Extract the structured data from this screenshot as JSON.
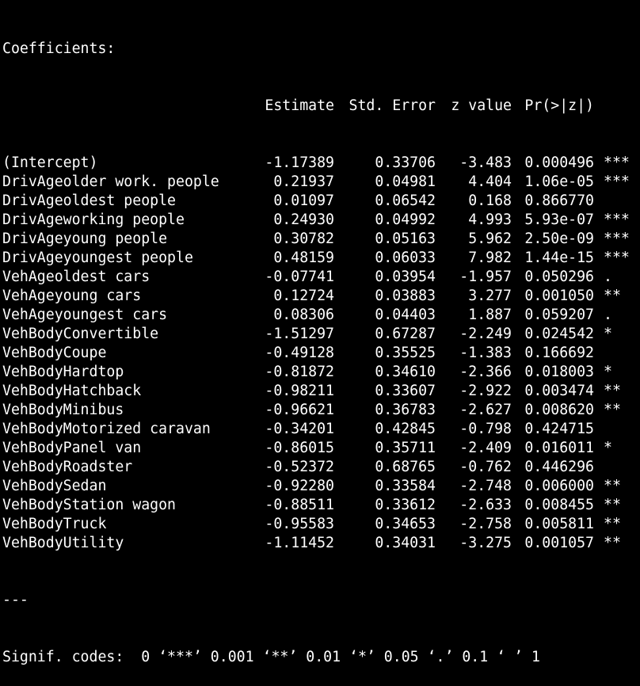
{
  "heading": "Coefficients:",
  "columns": [
    "Estimate",
    "Std. Error",
    "z value",
    "Pr(>|z|)"
  ],
  "rows": [
    {
      "name": "(Intercept)",
      "estimate": "-1.17389",
      "std_error": "0.33706",
      "z_value": "-3.483",
      "p_value": "0.000496",
      "signif": "***"
    },
    {
      "name": "DrivAgeolder work. people",
      "estimate": "0.21937",
      "std_error": "0.04981",
      "z_value": "4.404",
      "p_value": "1.06e-05",
      "signif": "***"
    },
    {
      "name": "DrivAgeoldest people",
      "estimate": "0.01097",
      "std_error": "0.06542",
      "z_value": "0.168",
      "p_value": "0.866770",
      "signif": ""
    },
    {
      "name": "DrivAgeworking people",
      "estimate": "0.24930",
      "std_error": "0.04992",
      "z_value": "4.993",
      "p_value": "5.93e-07",
      "signif": "***"
    },
    {
      "name": "DrivAgeyoung people",
      "estimate": "0.30782",
      "std_error": "0.05163",
      "z_value": "5.962",
      "p_value": "2.50e-09",
      "signif": "***"
    },
    {
      "name": "DrivAgeyoungest people",
      "estimate": "0.48159",
      "std_error": "0.06033",
      "z_value": "7.982",
      "p_value": "1.44e-15",
      "signif": "***"
    },
    {
      "name": "VehAgeoldest cars",
      "estimate": "-0.07741",
      "std_error": "0.03954",
      "z_value": "-1.957",
      "p_value": "0.050296",
      "signif": "."
    },
    {
      "name": "VehAgeyoung cars",
      "estimate": "0.12724",
      "std_error": "0.03883",
      "z_value": "3.277",
      "p_value": "0.001050",
      "signif": "**"
    },
    {
      "name": "VehAgeyoungest cars",
      "estimate": "0.08306",
      "std_error": "0.04403",
      "z_value": "1.887",
      "p_value": "0.059207",
      "signif": "."
    },
    {
      "name": "VehBodyConvertible",
      "estimate": "-1.51297",
      "std_error": "0.67287",
      "z_value": "-2.249",
      "p_value": "0.024542",
      "signif": "*"
    },
    {
      "name": "VehBodyCoupe",
      "estimate": "-0.49128",
      "std_error": "0.35525",
      "z_value": "-1.383",
      "p_value": "0.166692",
      "signif": ""
    },
    {
      "name": "VehBodyHardtop",
      "estimate": "-0.81872",
      "std_error": "0.34610",
      "z_value": "-2.366",
      "p_value": "0.018003",
      "signif": "*"
    },
    {
      "name": "VehBodyHatchback",
      "estimate": "-0.98211",
      "std_error": "0.33607",
      "z_value": "-2.922",
      "p_value": "0.003474",
      "signif": "**"
    },
    {
      "name": "VehBodyMinibus",
      "estimate": "-0.96621",
      "std_error": "0.36783",
      "z_value": "-2.627",
      "p_value": "0.008620",
      "signif": "**"
    },
    {
      "name": "VehBodyMotorized caravan",
      "estimate": "-0.34201",
      "std_error": "0.42845",
      "z_value": "-0.798",
      "p_value": "0.424715",
      "signif": ""
    },
    {
      "name": "VehBodyPanel van",
      "estimate": "-0.86015",
      "std_error": "0.35711",
      "z_value": "-2.409",
      "p_value": "0.016011",
      "signif": "*"
    },
    {
      "name": "VehBodyRoadster",
      "estimate": "-0.52372",
      "std_error": "0.68765",
      "z_value": "-0.762",
      "p_value": "0.446296",
      "signif": ""
    },
    {
      "name": "VehBodySedan",
      "estimate": "-0.92280",
      "std_error": "0.33584",
      "z_value": "-2.748",
      "p_value": "0.006000",
      "signif": "**"
    },
    {
      "name": "VehBodyStation wagon",
      "estimate": "-0.88511",
      "std_error": "0.33612",
      "z_value": "-2.633",
      "p_value": "0.008455",
      "signif": "**"
    },
    {
      "name": "VehBodyTruck",
      "estimate": "-0.95583",
      "std_error": "0.34653",
      "z_value": "-2.758",
      "p_value": "0.005811",
      "signif": "**"
    },
    {
      "name": "VehBodyUtility",
      "estimate": "-1.11452",
      "std_error": "0.34031",
      "z_value": "-3.275",
      "p_value": "0.001057",
      "signif": "**"
    }
  ],
  "separator": "---",
  "signif_codes": "Signif. codes:  0 ‘***’ 0.001 ‘**’ 0.01 ‘*’ 0.05 ‘.’ 0.1 ‘ ’ 1",
  "colors": {
    "background": "#000000",
    "text": "#ffffff"
  }
}
